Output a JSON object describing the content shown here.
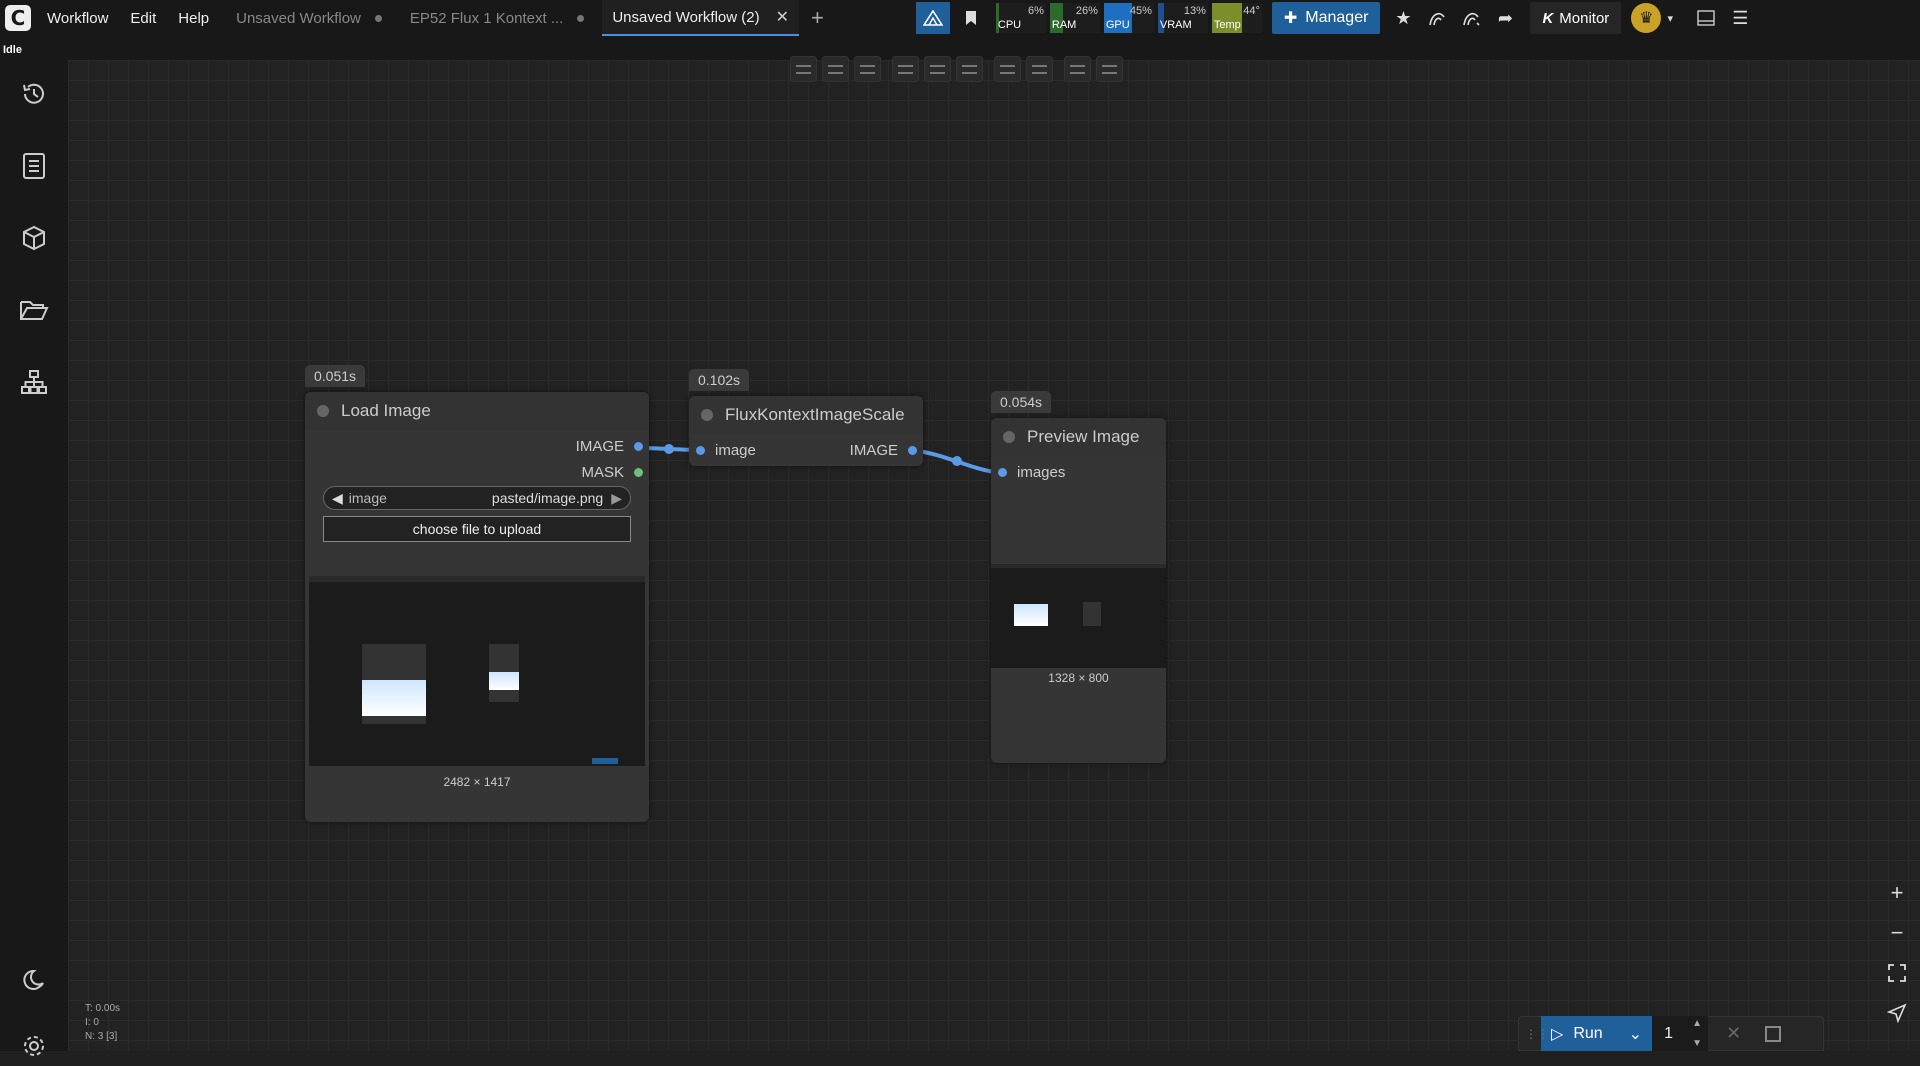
{
  "menu": {
    "workflow": "Workflow",
    "edit": "Edit",
    "help": "Help"
  },
  "tabs": [
    {
      "label": "Unsaved Workflow"
    },
    {
      "label": "EP52 Flux 1 Kontext ..."
    },
    {
      "label": "Unsaved Workflow (2)"
    }
  ],
  "stats": [
    {
      "label": "CPU",
      "value": "6%",
      "level": 0.06,
      "color": "#2d6b2d"
    },
    {
      "label": "RAM",
      "value": "26%",
      "level": 0.26,
      "color": "#2d6b2d"
    },
    {
      "label": "GPU",
      "value": "45%",
      "level": 0.45,
      "color": "#1e6fbf"
    },
    {
      "label": "VRAM",
      "value": "13%",
      "level": 0.13,
      "color": "#1e4f8f"
    },
    {
      "label": "Temp",
      "value": "44°",
      "level": 0.44,
      "color": "#7a8f2a"
    }
  ],
  "toolbar": {
    "manager_label": "Manager",
    "monitor_label": "Monitor"
  },
  "status": "Idle",
  "nodes": {
    "load": {
      "time": "0.051s",
      "title": "Load Image",
      "out_image": "IMAGE",
      "out_mask": "MASK",
      "combo_name": "image",
      "combo_value": "pasted/image.png",
      "upload_label": "choose file to upload",
      "dims": "2482 × 1417"
    },
    "scale": {
      "time": "0.102s",
      "title": "FluxKontextImageScale",
      "in_image": "image",
      "out_image": "IMAGE"
    },
    "preview": {
      "time": "0.054s",
      "title": "Preview Image",
      "in_images": "images",
      "dims": "1328 × 800"
    }
  },
  "run": {
    "label": "Run",
    "batch": "1"
  },
  "canvas_stats": [
    "T: 0.00s",
    "I: 0",
    "N: 3 [3]"
  ],
  "icons": [
    "history-icon",
    "queue-icon",
    "cube-icon",
    "folder-icon",
    "workflow-tree-icon",
    "moon-icon",
    "settings-icon",
    "zoom-in-icon",
    "zoom-out-icon",
    "fit-view-icon",
    "send-icon"
  ]
}
